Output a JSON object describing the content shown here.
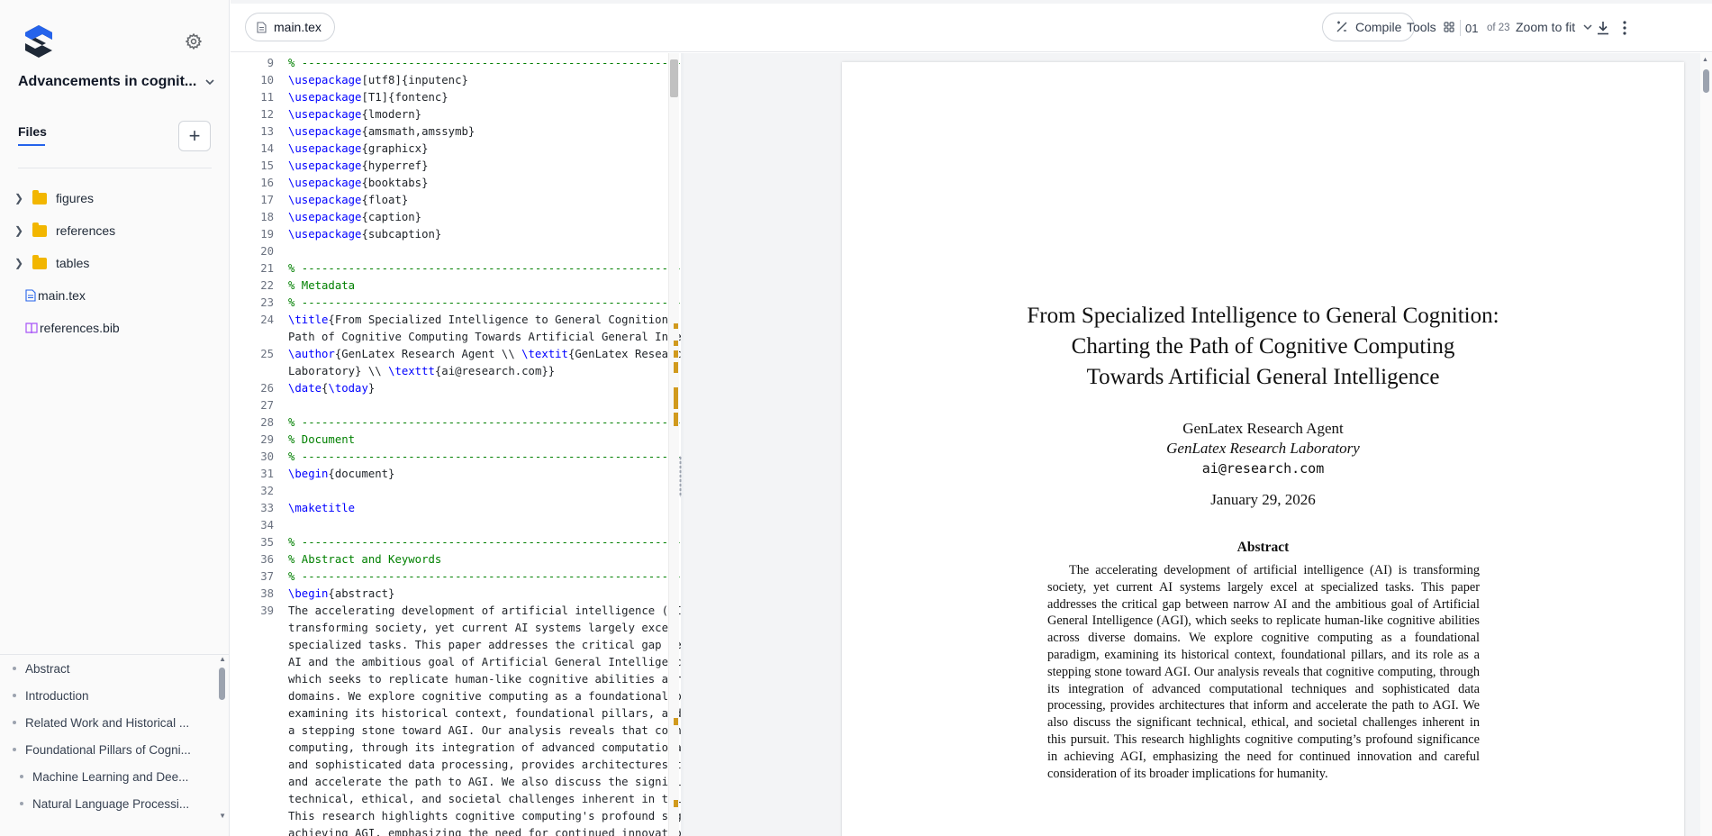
{
  "sidebar": {
    "project_title": "Advancements in cognit...",
    "files_tab": "Files",
    "add_label": "+",
    "tree": [
      {
        "type": "folder",
        "label": "figures"
      },
      {
        "type": "folder",
        "label": "references"
      },
      {
        "type": "folder",
        "label": "tables"
      },
      {
        "type": "tex",
        "label": "main.tex"
      },
      {
        "type": "bib",
        "label": "references.bib"
      }
    ],
    "outline": [
      {
        "label": "Abstract",
        "level": 1
      },
      {
        "label": "Introduction",
        "level": 1
      },
      {
        "label": "Related Work and Historical ...",
        "level": 1
      },
      {
        "label": "Foundational Pillars of Cogni...",
        "level": 1
      },
      {
        "label": "Machine Learning and Dee...",
        "level": 2
      },
      {
        "label": "Natural Language Processi...",
        "level": 2
      }
    ]
  },
  "toolbar": {
    "file_tab": "main.tex",
    "compile": "Compile",
    "tools": "Tools",
    "page_current": "01",
    "page_of": "of 23",
    "zoom": "Zoom to fit"
  },
  "editor": {
    "lines": [
      {
        "n": "9",
        "segs": [
          {
            "c": "cmt",
            "t": "% -------------------------------------------------------------"
          }
        ]
      },
      {
        "n": "10",
        "segs": [
          {
            "c": "cmd",
            "t": "\\usepackage"
          },
          {
            "c": "",
            "t": "[utf8]{inputenc}"
          }
        ]
      },
      {
        "n": "11",
        "segs": [
          {
            "c": "cmd",
            "t": "\\usepackage"
          },
          {
            "c": "",
            "t": "[T1]{fontenc}"
          }
        ]
      },
      {
        "n": "12",
        "segs": [
          {
            "c": "cmd",
            "t": "\\usepackage"
          },
          {
            "c": "",
            "t": "{lmodern}"
          }
        ]
      },
      {
        "n": "13",
        "segs": [
          {
            "c": "cmd",
            "t": "\\usepackage"
          },
          {
            "c": "",
            "t": "{amsmath,amssymb}"
          }
        ]
      },
      {
        "n": "14",
        "segs": [
          {
            "c": "cmd",
            "t": "\\usepackage"
          },
          {
            "c": "",
            "t": "{graphicx}"
          }
        ]
      },
      {
        "n": "15",
        "segs": [
          {
            "c": "cmd",
            "t": "\\usepackage"
          },
          {
            "c": "",
            "t": "{hyperref}"
          }
        ]
      },
      {
        "n": "16",
        "segs": [
          {
            "c": "cmd",
            "t": "\\usepackage"
          },
          {
            "c": "",
            "t": "{booktabs}"
          }
        ]
      },
      {
        "n": "17",
        "segs": [
          {
            "c": "cmd",
            "t": "\\usepackage"
          },
          {
            "c": "",
            "t": "{float}"
          }
        ]
      },
      {
        "n": "18",
        "segs": [
          {
            "c": "cmd",
            "t": "\\usepackage"
          },
          {
            "c": "",
            "t": "{caption}"
          }
        ]
      },
      {
        "n": "19",
        "segs": [
          {
            "c": "cmd",
            "t": "\\usepackage"
          },
          {
            "c": "",
            "t": "{subcaption}"
          }
        ]
      },
      {
        "n": "20",
        "segs": []
      },
      {
        "n": "21",
        "segs": [
          {
            "c": "cmt",
            "t": "% -------------------------------------------------------------"
          }
        ]
      },
      {
        "n": "22",
        "segs": [
          {
            "c": "cmt",
            "t": "% Metadata"
          }
        ]
      },
      {
        "n": "23",
        "segs": [
          {
            "c": "cmt",
            "t": "% -------------------------------------------------------------"
          }
        ]
      },
      {
        "n": "24",
        "segs": [
          {
            "c": "cmd",
            "t": "\\title"
          },
          {
            "c": "",
            "t": "{From Specialized Intelligence to General Cognition: Charting the"
          }
        ]
      },
      {
        "n": "",
        "segs": [
          {
            "c": "",
            "t": "Path of Cognitive Computing Towards Artificial General Intelligence}"
          }
        ]
      },
      {
        "n": "25",
        "segs": [
          {
            "c": "cmd",
            "t": "\\author"
          },
          {
            "c": "",
            "t": "{GenLatex Research Agent \\\\ "
          },
          {
            "c": "cmd",
            "t": "\\textit"
          },
          {
            "c": "",
            "t": "{GenLatex Research"
          }
        ]
      },
      {
        "n": "",
        "segs": [
          {
            "c": "",
            "t": "Laboratory} \\\\ "
          },
          {
            "c": "cmd",
            "t": "\\texttt"
          },
          {
            "c": "",
            "t": "{ai@research.com}}"
          }
        ]
      },
      {
        "n": "26",
        "segs": [
          {
            "c": "cmd",
            "t": "\\date"
          },
          {
            "c": "",
            "t": "{"
          },
          {
            "c": "cmd",
            "t": "\\today"
          },
          {
            "c": "",
            "t": "}"
          }
        ]
      },
      {
        "n": "27",
        "segs": []
      },
      {
        "n": "28",
        "segs": [
          {
            "c": "cmt",
            "t": "% -------------------------------------------------------------"
          }
        ]
      },
      {
        "n": "29",
        "segs": [
          {
            "c": "cmt",
            "t": "% Document"
          }
        ]
      },
      {
        "n": "30",
        "segs": [
          {
            "c": "cmt",
            "t": "% -------------------------------------------------------------"
          }
        ]
      },
      {
        "n": "31",
        "segs": [
          {
            "c": "cmd",
            "t": "\\begin"
          },
          {
            "c": "",
            "t": "{document}"
          }
        ]
      },
      {
        "n": "32",
        "segs": []
      },
      {
        "n": "33",
        "segs": [
          {
            "c": "cmd",
            "t": "\\maketitle"
          }
        ]
      },
      {
        "n": "34",
        "segs": []
      },
      {
        "n": "35",
        "segs": [
          {
            "c": "cmt",
            "t": "% -------------------------------------------------------------"
          }
        ]
      },
      {
        "n": "36",
        "segs": [
          {
            "c": "cmt",
            "t": "% Abstract and Keywords"
          }
        ]
      },
      {
        "n": "37",
        "segs": [
          {
            "c": "cmt",
            "t": "% -------------------------------------------------------------"
          }
        ]
      },
      {
        "n": "38",
        "segs": [
          {
            "c": "cmd",
            "t": "\\begin"
          },
          {
            "c": "",
            "t": "{abstract}"
          }
        ]
      },
      {
        "n": "39",
        "segs": [
          {
            "c": "",
            "t": "The accelerating development of artificial intelligence (AI) is"
          }
        ]
      },
      {
        "n": "",
        "segs": [
          {
            "c": "",
            "t": "transforming society, yet current AI systems largely excel at"
          }
        ]
      },
      {
        "n": "",
        "segs": [
          {
            "c": "",
            "t": "specialized tasks. This paper addresses the critical gap between narrow"
          }
        ]
      },
      {
        "n": "",
        "segs": [
          {
            "c": "",
            "t": "AI and the ambitious goal of Artificial General Intelligence (AGI),"
          }
        ]
      },
      {
        "n": "",
        "segs": [
          {
            "c": "",
            "t": "which seeks to replicate human-like cognitive abilities across diverse"
          }
        ]
      },
      {
        "n": "",
        "segs": [
          {
            "c": "",
            "t": "domains. We explore cognitive computing as a foundational paradigm,"
          }
        ]
      },
      {
        "n": "",
        "segs": [
          {
            "c": "",
            "t": "examining its historical context, foundational pillars, and its role as"
          }
        ]
      },
      {
        "n": "",
        "segs": [
          {
            "c": "",
            "t": "a stepping stone toward AGI. Our analysis reveals that cognitive"
          }
        ]
      },
      {
        "n": "",
        "segs": [
          {
            "c": "",
            "t": "computing, through its integration of advanced computational techniques"
          }
        ]
      },
      {
        "n": "",
        "segs": [
          {
            "c": "",
            "t": "and sophisticated data processing, provides architectures that inform"
          }
        ]
      },
      {
        "n": "",
        "segs": [
          {
            "c": "",
            "t": "and accelerate the path to AGI. We also discuss the significant"
          }
        ]
      },
      {
        "n": "",
        "segs": [
          {
            "c": "",
            "t": "technical, ethical, and societal challenges inherent in this pursuit."
          }
        ]
      },
      {
        "n": "",
        "segs": [
          {
            "c": "",
            "t": "This research highlights cognitive computing's profound significance in"
          }
        ]
      },
      {
        "n": "",
        "segs": [
          {
            "c": "",
            "t": "achieving AGI, emphasizing the need for continued innovation and"
          }
        ]
      }
    ]
  },
  "preview": {
    "title_lines": [
      "From Specialized Intelligence to General Cognition:",
      "Charting the Path of Cognitive Computing",
      "Towards Artificial General Intelligence"
    ],
    "author": "GenLatex Research Agent",
    "institution": "GenLatex Research Laboratory",
    "email": "ai@research.com",
    "date": "January 29, 2026",
    "abstract_heading": "Abstract",
    "abstract_text": "The accelerating development of artificial intelligence (AI) is transforming society, yet current AI systems largely excel at specialized tasks. This paper addresses the critical gap between narrow AI and the ambitious goal of Artificial General Intelligence (AGI), which seeks to replicate human-like cognitive abilities across diverse domains. We explore cognitive computing as a foundational paradigm, examining its historical context, foundational pillars, and its role as a stepping stone toward AGI. Our analysis reveals that cognitive computing, through its integration of advanced computational techniques and sophisticated data processing, provides architectures that inform and accelerate the path to AGI. We also discuss the significant technical, ethical, and societal challenges inherent in this pursuit. This research highlights cognitive computing’s profound significance in achieving AGI, emphasizing the need for continued innovation and careful consideration of its broader implications for humanity."
  },
  "colors": {
    "accent": "#2563eb",
    "latex_command": "#0000ff",
    "latex_comment": "#008000",
    "folder": "#f2b600",
    "bib_icon": "#a855f7",
    "scroll_marker": "#d19a1e"
  }
}
